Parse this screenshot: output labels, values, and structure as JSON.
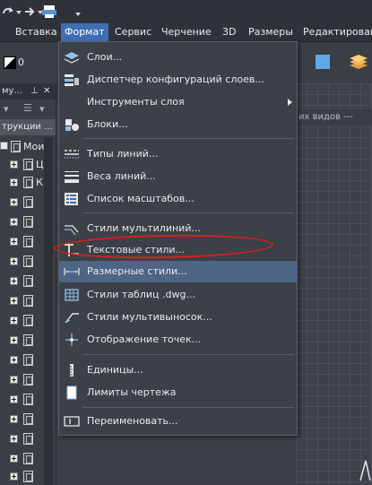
{
  "menubar": {
    "items": [
      {
        "label": "Вставка"
      },
      {
        "label": "Формат"
      },
      {
        "label": "Сервис"
      },
      {
        "label": "Черчение"
      },
      {
        "label": "3D"
      },
      {
        "label": "Размеры"
      },
      {
        "label": "Редактирование"
      }
    ]
  },
  "toolbar": {
    "layer_value": "0"
  },
  "left_panel": {
    "header": "му...",
    "tab": "трукции ...",
    "root_label": "Мои",
    "row2_label": "Ц",
    "row3_label": "К"
  },
  "canvas": {
    "view_label": "их видов ---"
  },
  "format_menu": {
    "items": [
      {
        "label": "Слои...",
        "icon": "layers-icon"
      },
      {
        "label": "Диспетчер конфигураций слоев...",
        "icon": "layer-config-icon"
      },
      {
        "label": "Инструменты слоя",
        "icon": "",
        "submenu": true
      },
      {
        "label": "Блоки...",
        "icon": "blocks-icon"
      },
      {
        "label": "Типы линий...",
        "icon": "linetypes-icon"
      },
      {
        "label": "Веса линий...",
        "icon": "lineweights-icon"
      },
      {
        "label": "Список масштабов...",
        "icon": "scale-list-icon"
      },
      {
        "label": "Стили мультилиний...",
        "icon": "multiline-styles-icon"
      },
      {
        "label": "Текстовые стили...",
        "icon": "text-styles-icon"
      },
      {
        "label": "Размерные стили...",
        "icon": "dimension-styles-icon",
        "highlighted": true
      },
      {
        "label": "Стили таблиц .dwg...",
        "icon": "table-styles-icon"
      },
      {
        "label": "Стили мультивыносок...",
        "icon": "multileader-styles-icon"
      },
      {
        "label": "Отображение точек...",
        "icon": "point-display-icon"
      },
      {
        "label": "Единицы...",
        "icon": "units-icon"
      },
      {
        "label": "Лимиты чертежа",
        "icon": "drawing-limits-icon"
      },
      {
        "label": "Переименовать...",
        "icon": "rename-icon"
      }
    ]
  },
  "colors": {
    "menu_bg": "#3c4047",
    "highlight": "#4e6584",
    "active_menu": "#3f6fb2",
    "annotation": "#d62020"
  }
}
